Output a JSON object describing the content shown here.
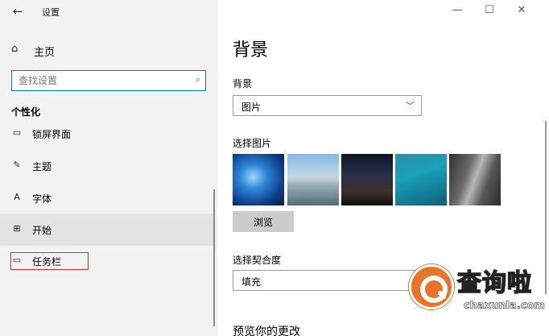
{
  "window": {
    "title": "设置"
  },
  "sidebar": {
    "home_label": "主页",
    "search_placeholder": "查找设置",
    "section_title": "个性化",
    "items": [
      {
        "label": "锁屏界面",
        "icon": "lock-screen-icon"
      },
      {
        "label": "主题",
        "icon": "theme-icon"
      },
      {
        "label": "字体",
        "icon": "font-icon"
      },
      {
        "label": "开始",
        "icon": "start-icon",
        "state": "hover"
      },
      {
        "label": "任务栏",
        "icon": "taskbar-icon",
        "highlighted": true
      }
    ]
  },
  "main": {
    "page_title": "背景",
    "background_label": "背景",
    "background_value": "图片",
    "choose_picture_label": "选择图片",
    "browse_button": "浏览",
    "fit_label": "选择契合度",
    "fit_value": "填充",
    "preview_label": "预览你的更改"
  },
  "watermark": {
    "text": "查询啦",
    "url": "chaxunla.com"
  },
  "colors": {
    "sidebar_bg": "#f2f2f2",
    "accent": "#0078d7",
    "highlight_box": "#d9302c",
    "watermark_orange": "#e8732a"
  }
}
